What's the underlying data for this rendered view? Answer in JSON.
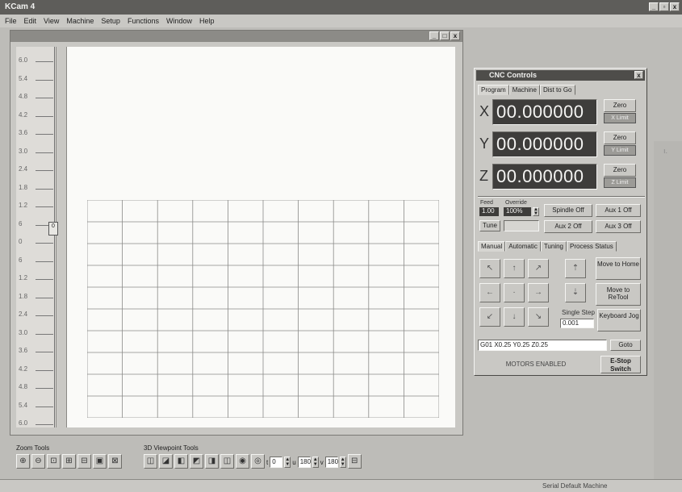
{
  "app": {
    "title": "KCam 4",
    "minimize": "_",
    "maximize": "▫",
    "close": "x"
  },
  "menu": [
    "File",
    "Edit",
    "View",
    "Machine",
    "Setup",
    "Functions",
    "Window",
    "Help"
  ],
  "document": {
    "minimize": "_",
    "maximize": "□",
    "close": "x",
    "ruler_labels": [
      "6.0",
      "5.4",
      "4.8",
      "4.2",
      "3.6",
      "3.0",
      "2.4",
      "1.8",
      "1.2",
      "6",
      "0",
      "6",
      "1.2",
      "1.8",
      "2.4",
      "3.0",
      "3.6",
      "4.2",
      "4.8",
      "5.4",
      "6.0"
    ],
    "slider_value": "0"
  },
  "toolbars": {
    "zoom_label": "Zoom Tools",
    "view_label": "3D Viewpoint Tools",
    "zoom_buttons": [
      "⊕",
      "⊖",
      "⊡",
      "⊞",
      "⊟",
      "▣",
      "⊠"
    ],
    "view_buttons": [
      "◫",
      "◪",
      "◧",
      "◩",
      "◨",
      "◫",
      "◉",
      "◎"
    ],
    "t_label": "t",
    "t_value": "0",
    "u_label": "u",
    "u_value": "180",
    "v_label": "v",
    "v_value": "180",
    "extra_button": "⊟"
  },
  "status": {
    "right": "Serial Default Machine"
  },
  "right_marker": "ı.",
  "cnc": {
    "title": "CNC Controls",
    "close": "x",
    "tabs": [
      "Program",
      "Machine",
      "Dist to Go"
    ],
    "axes": [
      {
        "letter": "X",
        "value": "00.000000",
        "zero": "Zero",
        "limit": "X Limit"
      },
      {
        "letter": "Y",
        "value": "00.000000",
        "zero": "Zero",
        "limit": "Y Limit"
      },
      {
        "letter": "Z",
        "value": "00.000000",
        "zero": "Zero",
        "limit": "Z Limit"
      }
    ],
    "feed_label": "Feed",
    "feed_value": "1.00",
    "override_label": "Override",
    "override_value": "100%",
    "tune_label": "Tune",
    "spindle": "Spindle Off",
    "aux1": "Aux 1 Off",
    "aux2": "Aux 2 Off",
    "aux3": "Aux 3 Off",
    "mode_tabs": [
      "Manual",
      "Automatic",
      "Tuning",
      "Process Status"
    ],
    "move_home": "Move to Home",
    "move_refeed": "Move to ReTool",
    "single_step": "Single Step",
    "step_value": "0.001",
    "keyboard_jog": "Keyboard Jog",
    "gcode": "G01 X0.25 Y0.25 Z0.25",
    "goto": "Goto",
    "motors": "MOTORS ENABLED",
    "estop": "E-Stop Switch"
  }
}
